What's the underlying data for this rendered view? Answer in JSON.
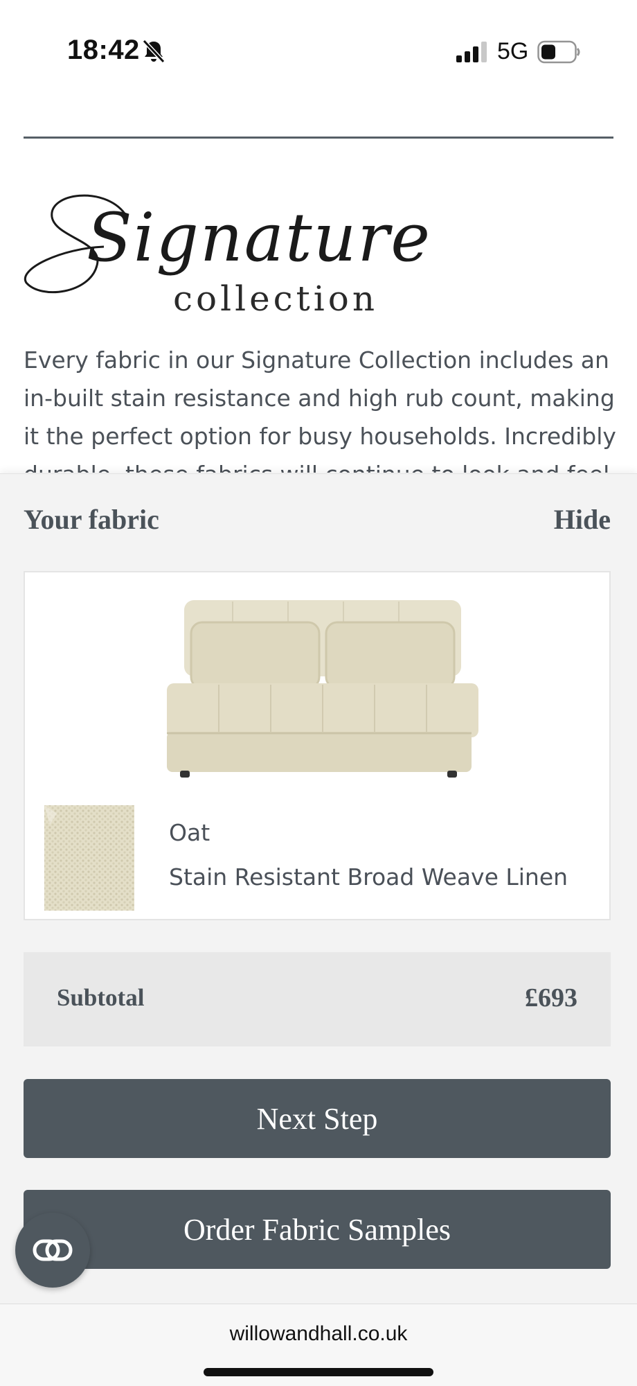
{
  "status_bar": {
    "time": "18:42",
    "network": "5G"
  },
  "logo": {
    "script_text": "Signature",
    "sub_text": "collection"
  },
  "description": "Every fabric in our Signature Collection includes an in-built stain resistance and high rub count, making it the perfect option for busy households. Incredibly durable, these fabrics will continue to look and feel",
  "panel": {
    "title": "Your fabric",
    "hide_label": "Hide",
    "fabric": {
      "name": "Oat",
      "description": "Stain Resistant Broad Weave Linen"
    },
    "subtotal": {
      "label": "Subtotal",
      "value": "£693"
    },
    "next_step_label": "Next Step",
    "order_samples_label": "Order Fabric Samples"
  },
  "browser": {
    "url": "willowandhall.co.uk"
  },
  "colors": {
    "button": "#4f585f",
    "panel": "#f3f3f3",
    "subtotal_bg": "#e8e8e8",
    "fabric": "#e4dfc8"
  }
}
